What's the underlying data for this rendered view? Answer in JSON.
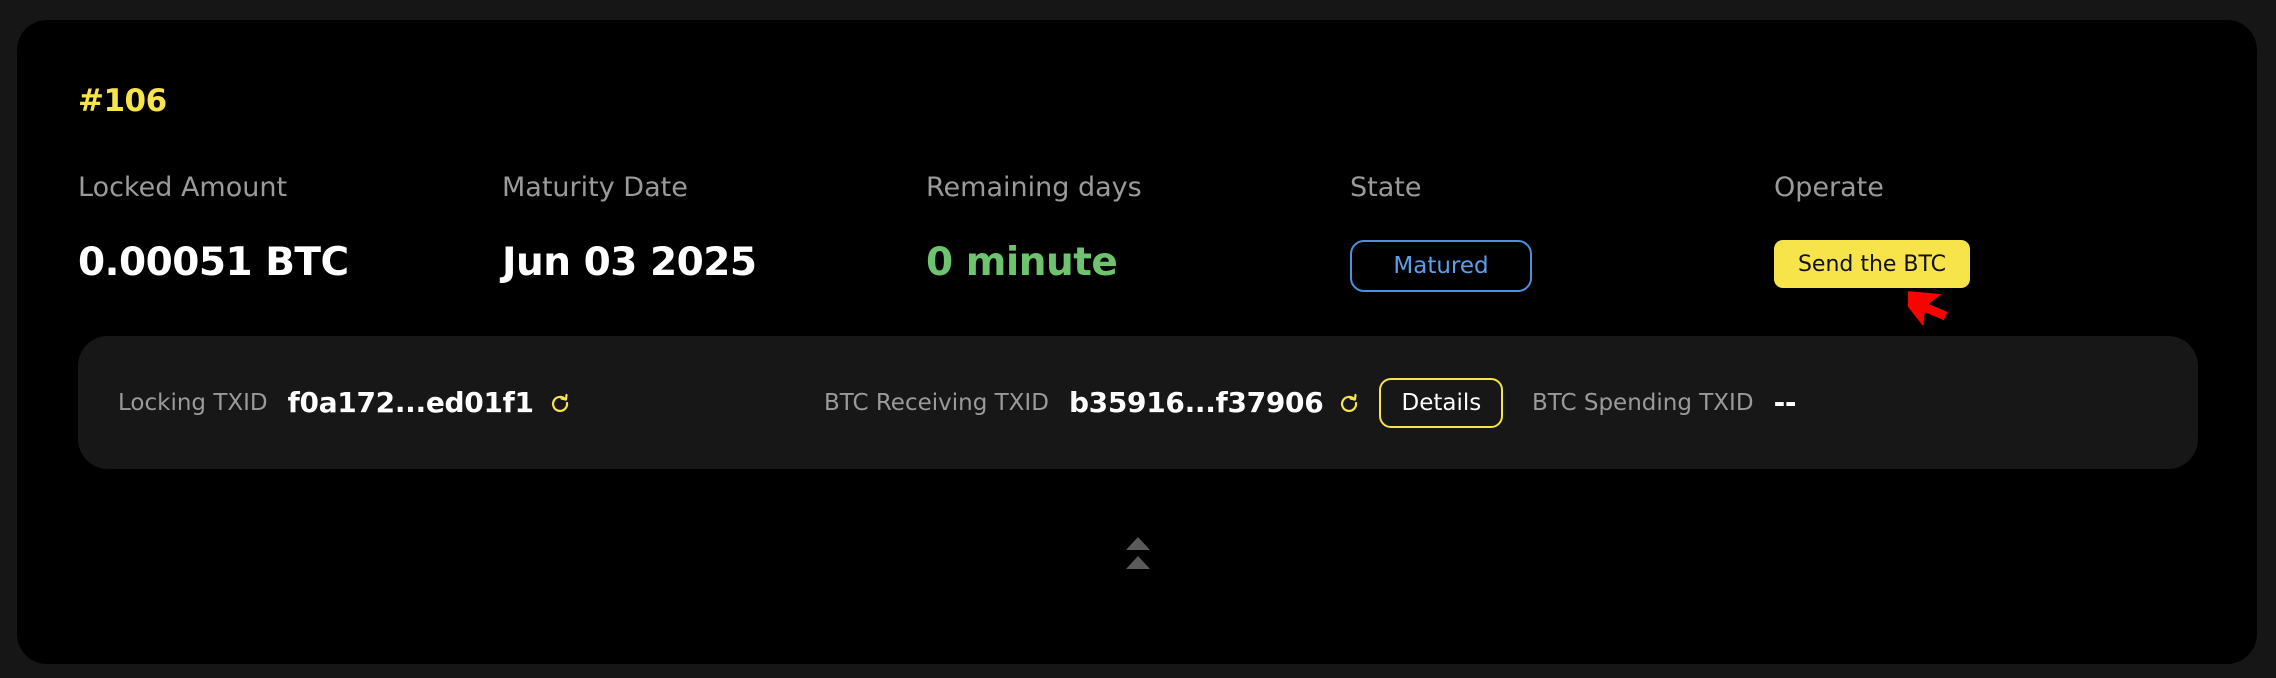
{
  "order": {
    "id": "#106"
  },
  "columns": {
    "locked_amount": {
      "label": "Locked Amount",
      "value": "0.00051 BTC"
    },
    "maturity_date": {
      "label": "Maturity Date",
      "value": "Jun 03 2025"
    },
    "remaining_days": {
      "label": "Remaining days",
      "value": "0 minute"
    },
    "state": {
      "label": "State",
      "value": "Matured"
    },
    "operate": {
      "label": "Operate",
      "button_label": "Send the BTC"
    }
  },
  "transactions": {
    "locking": {
      "label": "Locking TXID",
      "value": "f0a172...ed01f1"
    },
    "receiving": {
      "label": "BTC Receiving TXID",
      "value": "b35916...f37906",
      "details_label": "Details"
    },
    "spending": {
      "label": "BTC Spending TXID",
      "value": "--"
    }
  },
  "colors": {
    "accent": "#f7e34a",
    "state_border": "#4f8fdc",
    "remaining_green": "#6ec36e"
  },
  "icons": {
    "refresh": "refresh-icon",
    "collapse": "double-chevron-up-icon",
    "cursor": "mouse-pointer-icon"
  }
}
